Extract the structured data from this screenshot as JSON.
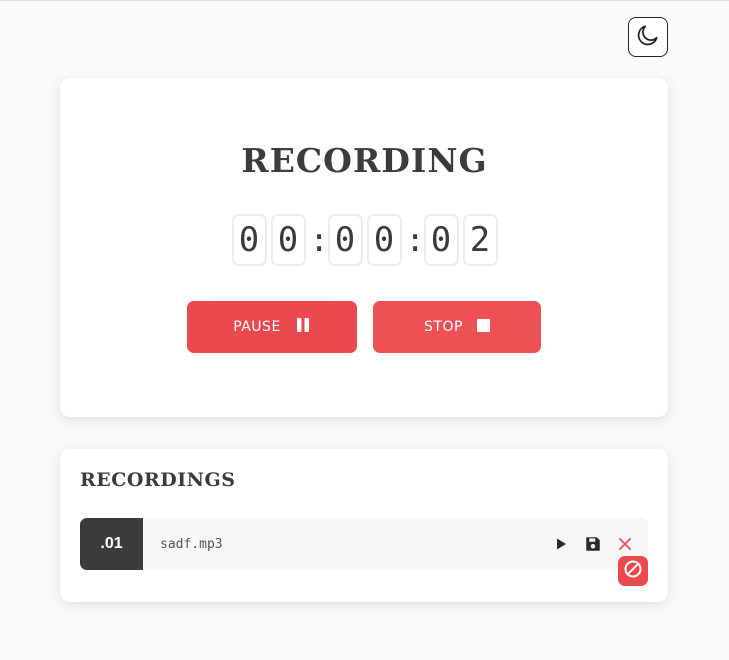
{
  "recorder": {
    "title": "RECORDING",
    "timer_digits": [
      "0",
      "0",
      "0",
      "0",
      "0",
      "2"
    ],
    "timer_separator": ":",
    "pause_label": "PAUSE",
    "stop_label": "STOP"
  },
  "recordings": {
    "title": "RECORDINGS",
    "items": [
      {
        "index": ".01",
        "filename": "sadf.mp3"
      }
    ]
  },
  "icons": {
    "theme": "moon-icon",
    "pause": "pause-icon",
    "stop": "stop-icon",
    "play": "play-icon",
    "save": "save-icon",
    "delete": "close-icon",
    "block": "block-icon"
  },
  "colors": {
    "accent": "#ea4a4f",
    "dark": "#3c3c3c",
    "background": "#f9f9f9"
  }
}
